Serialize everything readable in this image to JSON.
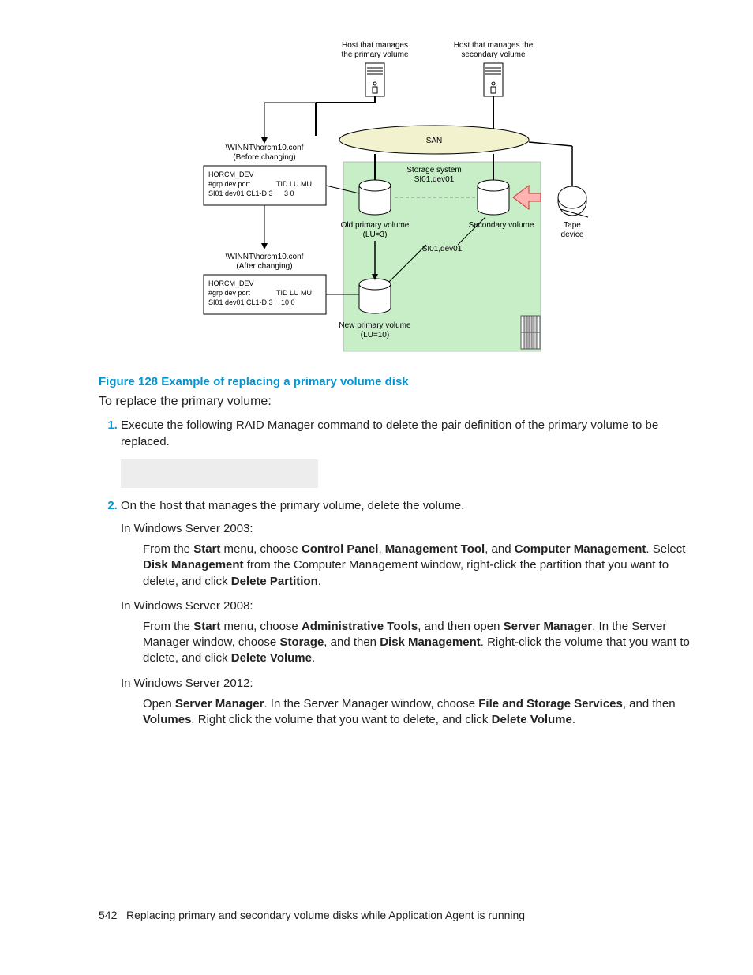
{
  "diagram": {
    "host_primary_label1": "Host that manages",
    "host_primary_label2": "the primary volume",
    "host_secondary_label1": "Host that manages the",
    "host_secondary_label2": "secondary volume",
    "before_conf_path": "\\WINNT\\horcm10.conf",
    "before_conf_note": "(Before changing)",
    "after_conf_path": "\\WINNT\\horcm10.conf",
    "after_conf_note": "(After changing)",
    "horcm_dev": "HORCM_DEV",
    "header_grp": "#grp  dev  port",
    "header_tid": "TID  LU   MU",
    "row_before": "SI01 dev01 CL1-D  3",
    "row_before_nums": "3      0",
    "row_after": "SI01 dev01 CL1-D  3",
    "row_after_nums": "10     0",
    "san": "SAN",
    "storage_system": "Storage system",
    "si01_dev01": "SI01,dev01",
    "old_primary1": "Old primary volume",
    "old_primary2": "(LU=3)",
    "secondary_volume": "Secondary volume",
    "tape1": "Tape",
    "tape2": "device",
    "new_primary1": "New primary volume",
    "new_primary2": "(LU=10)"
  },
  "caption": "Figure 128 Example of replacing a primary volume disk",
  "intro": "To replace the primary volume:",
  "step1": "Execute the following RAID Manager command to delete the pair definition of the primary volume to be replaced.",
  "step2": "On the host that manages the primary volume, delete the volume.",
  "ws2003_label": "In Windows Server 2003:",
  "ws2003": {
    "pre1": "From the ",
    "b_start": "Start",
    "t1": " menu, choose ",
    "b_cp": "Control Panel",
    "t2": ", ",
    "b_mt": "Management Tool",
    "t3": ", and ",
    "b_cm": "Computer Management",
    "t4": ". Select ",
    "b_dm": "Disk Management",
    "t5": " from the Computer Management window, right-click the partition that you want to delete, and click ",
    "b_dp": "Delete Partition",
    "t6": "."
  },
  "ws2008_label": "In Windows Server 2008:",
  "ws2008": {
    "pre1": "From the ",
    "b_start": "Start",
    "t1": " menu, choose ",
    "b_at": "Administrative Tools",
    "t2": ", and then open ",
    "b_sm": "Server Manager",
    "t3": ". In the Server Manager window, choose ",
    "b_st": "Storage",
    "t4": ", and then ",
    "b_dm": "Disk Management",
    "t5": ". Right-click the volume that you want to delete, and click ",
    "b_dv": "Delete Volume",
    "t6": "."
  },
  "ws2012_label": "In Windows Server 2012:",
  "ws2012": {
    "pre1": "Open ",
    "b_sm": "Server Manager",
    "t1": ". In the Server Manager window, choose ",
    "b_fs": "File and Storage Services",
    "t2": ", and then ",
    "b_vol": "Volumes",
    "t3": ". Right click the volume that you want to delete, and click ",
    "b_dv": "Delete Volume",
    "t4": "."
  },
  "footer_page": "542",
  "footer_text": "Replacing primary and secondary volume disks while Application Agent is running"
}
